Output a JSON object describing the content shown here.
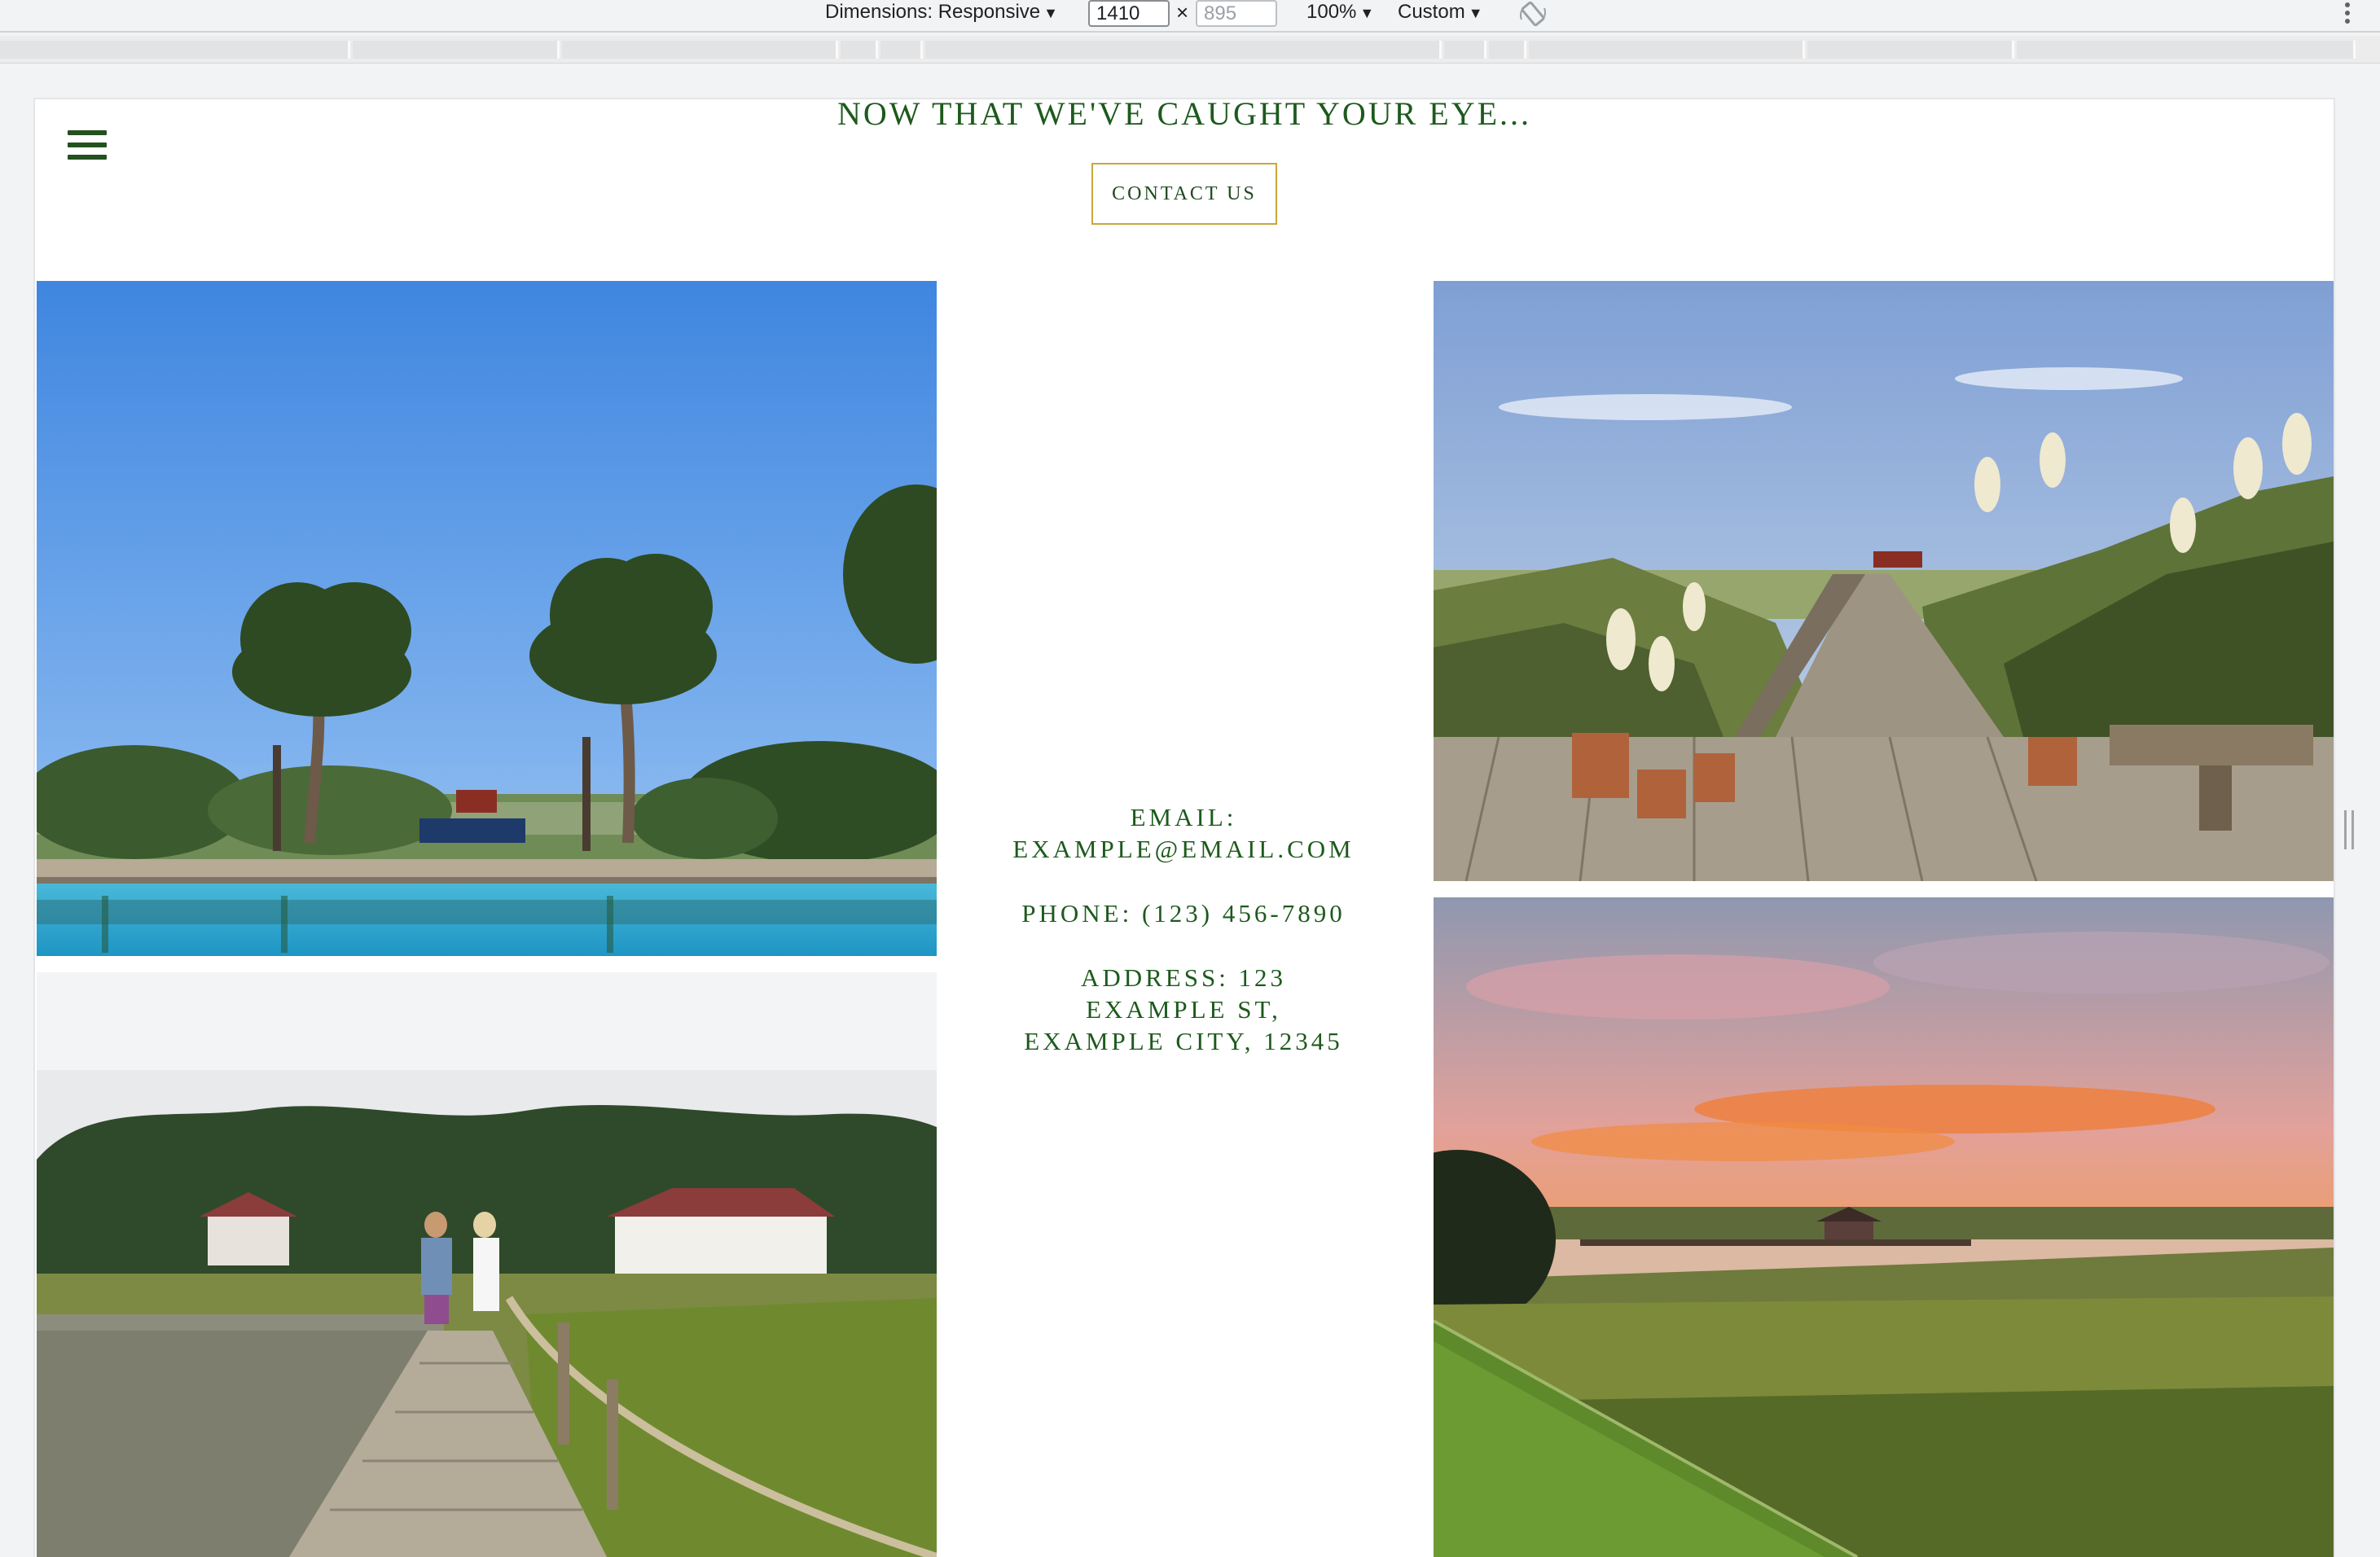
{
  "devtools": {
    "dimensions_label": "Dimensions: Responsive",
    "width_value": "1410",
    "times_symbol": "×",
    "height_placeholder": "895",
    "zoom": "100%",
    "throttle": "Custom"
  },
  "page": {
    "headline": "NOW THAT WE'VE CAUGHT YOUR EYE...",
    "contact_button": "CONTACT US",
    "contact": {
      "email_label": "EMAIL:",
      "email_value": "EXAMPLE@EMAIL.COM",
      "phone": "PHONE: (123) 456-7890",
      "address_line1": "ADDRESS: 123",
      "address_line2": "EXAMPLE ST,",
      "address_line3": "EXAMPLE CITY, 12345"
    }
  },
  "colors": {
    "brand_green": "#1d5a1d",
    "button_border_gold": "#c9a83a",
    "devtools_bg": "#f1f3f4"
  },
  "icons": {
    "menu": "hamburger-menu-icon",
    "rotate": "rotate-icon",
    "more": "more-vertical-icon"
  }
}
